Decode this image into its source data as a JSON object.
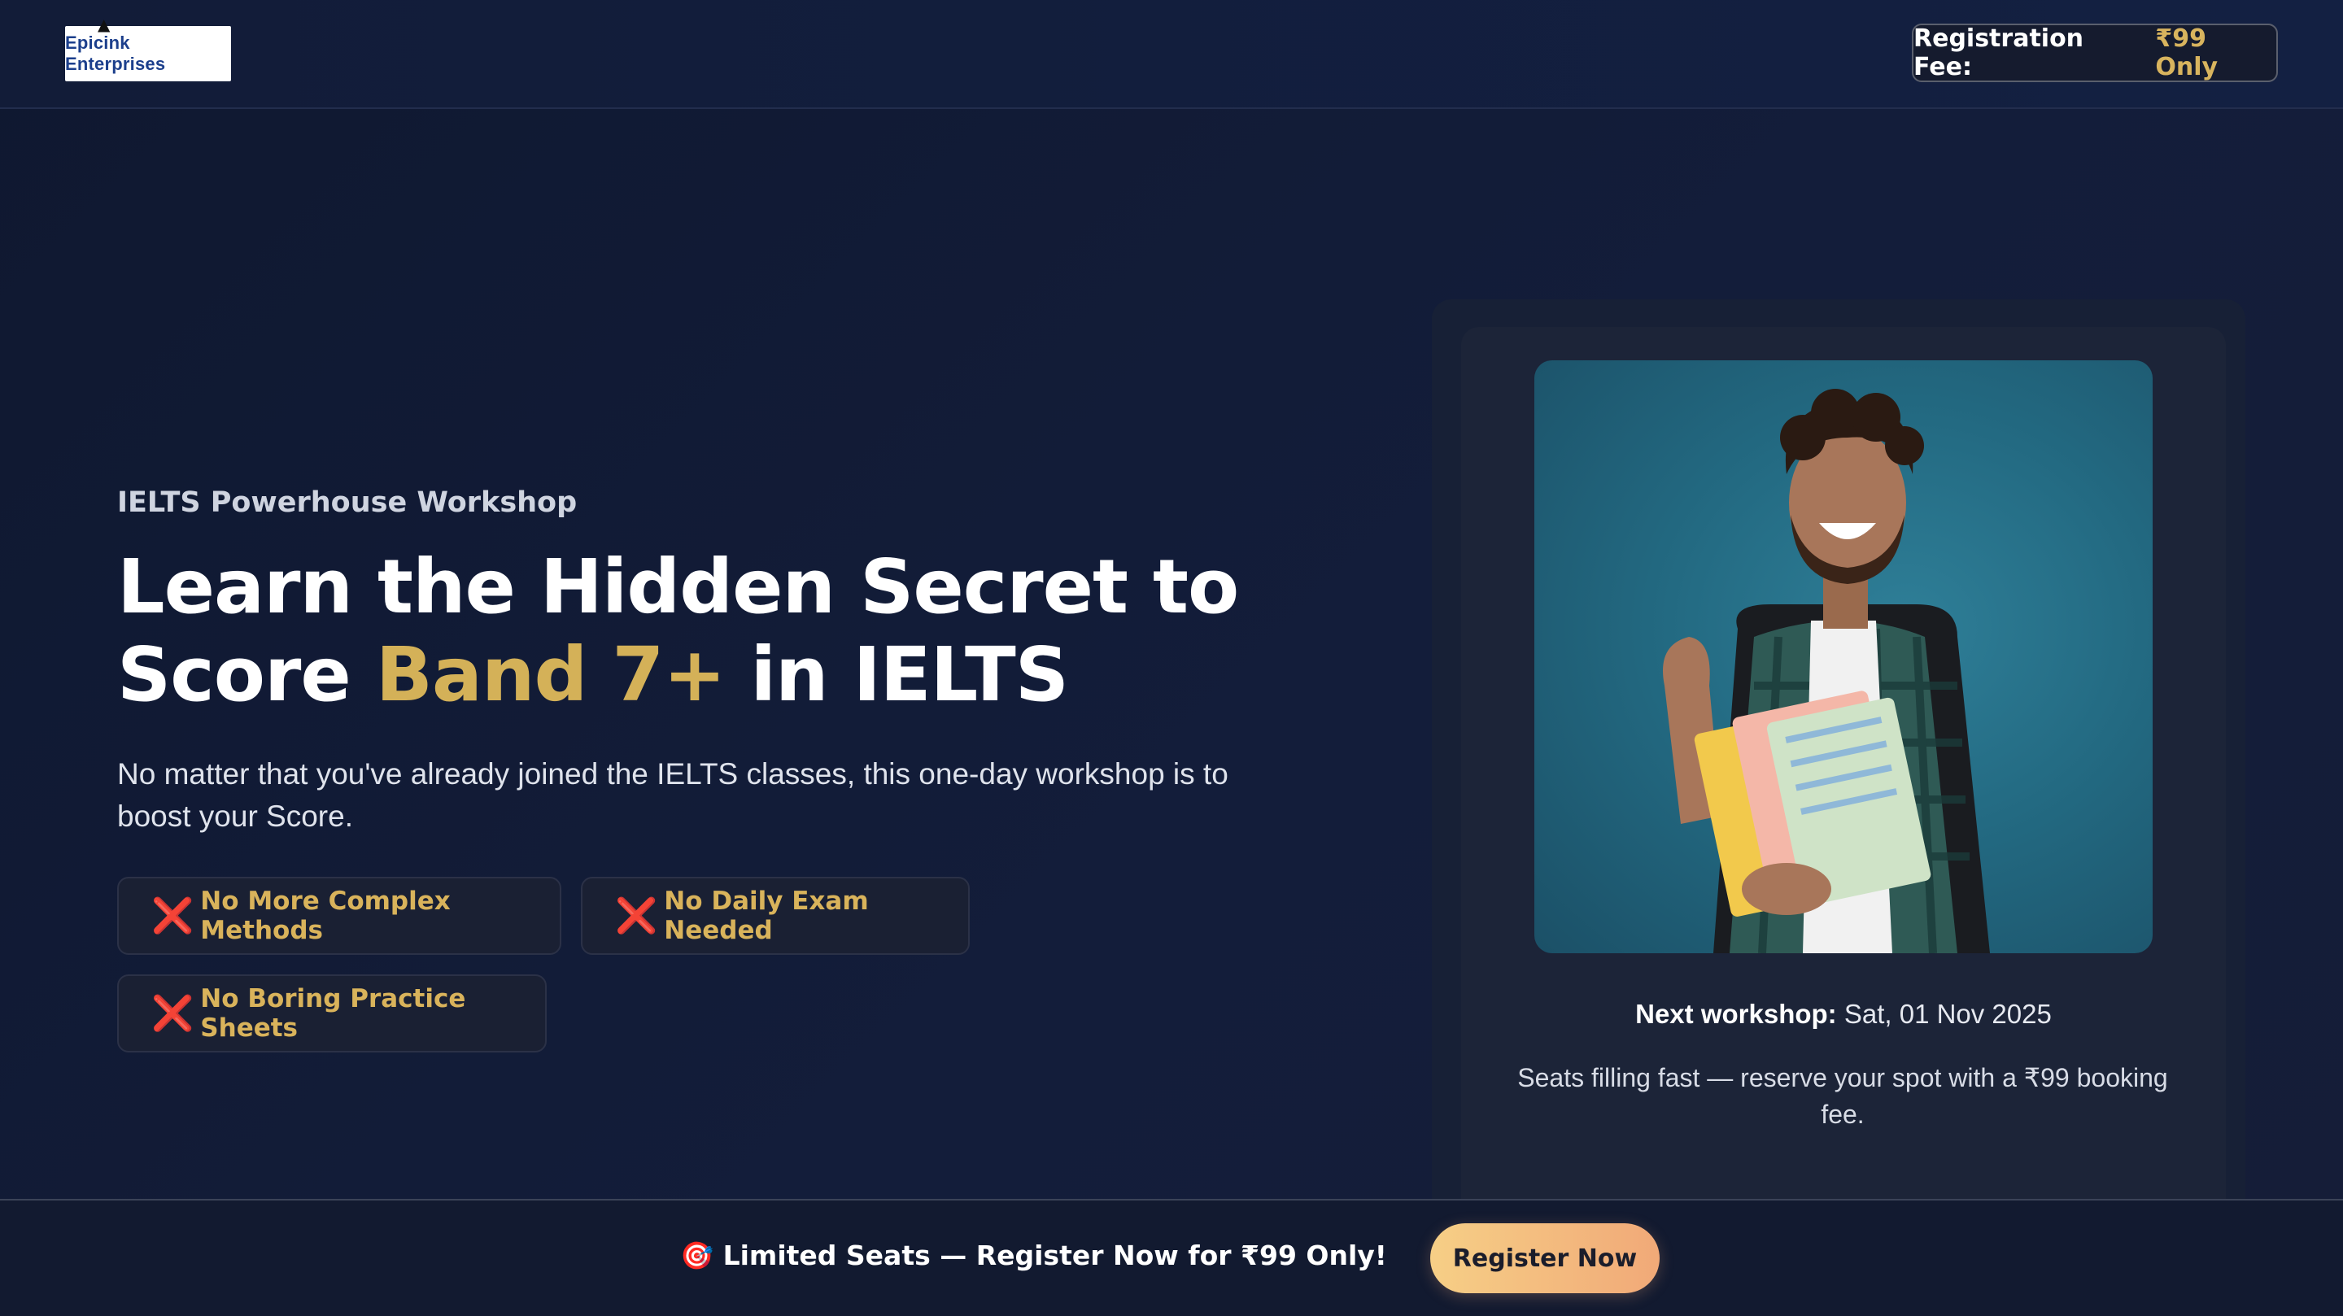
{
  "header": {
    "logo_text": "Epicink Enterprises",
    "fee_label": "Registration Fee:",
    "fee_value": "₹99 Only"
  },
  "hero": {
    "eyebrow": "IELTS Powerhouse Workshop",
    "headline_part1": "Learn the Hidden Secret to",
    "headline_part2": "Score ",
    "headline_highlight": "Band 7+",
    "headline_part3": " in IELTS",
    "subtext": "No matter that you've already joined the IELTS classes, this one-day workshop is to boost your Score.",
    "chips": [
      {
        "icon": "❌",
        "label": "No More Complex Methods"
      },
      {
        "icon": "❌",
        "label": "No Daily Exam Needed"
      },
      {
        "icon": "❌",
        "label": "No Boring Practice Sheets"
      }
    ]
  },
  "card": {
    "next_label": "Next workshop:",
    "next_value": " Sat, 01 Nov 2025",
    "note": "Seats filling fast — reserve your spot with a ₹99 booking fee."
  },
  "bottom_bar": {
    "icon": "🎯",
    "text": "Limited Seats — Register Now for ₹99 Only!",
    "button_label": "Register Now"
  },
  "colors": {
    "background": "#111a33",
    "accent_gold": "#d4b158",
    "cta_gradient_start": "#f6cf86",
    "cta_gradient_end": "#f1a978",
    "cross_red": "#e53935"
  }
}
